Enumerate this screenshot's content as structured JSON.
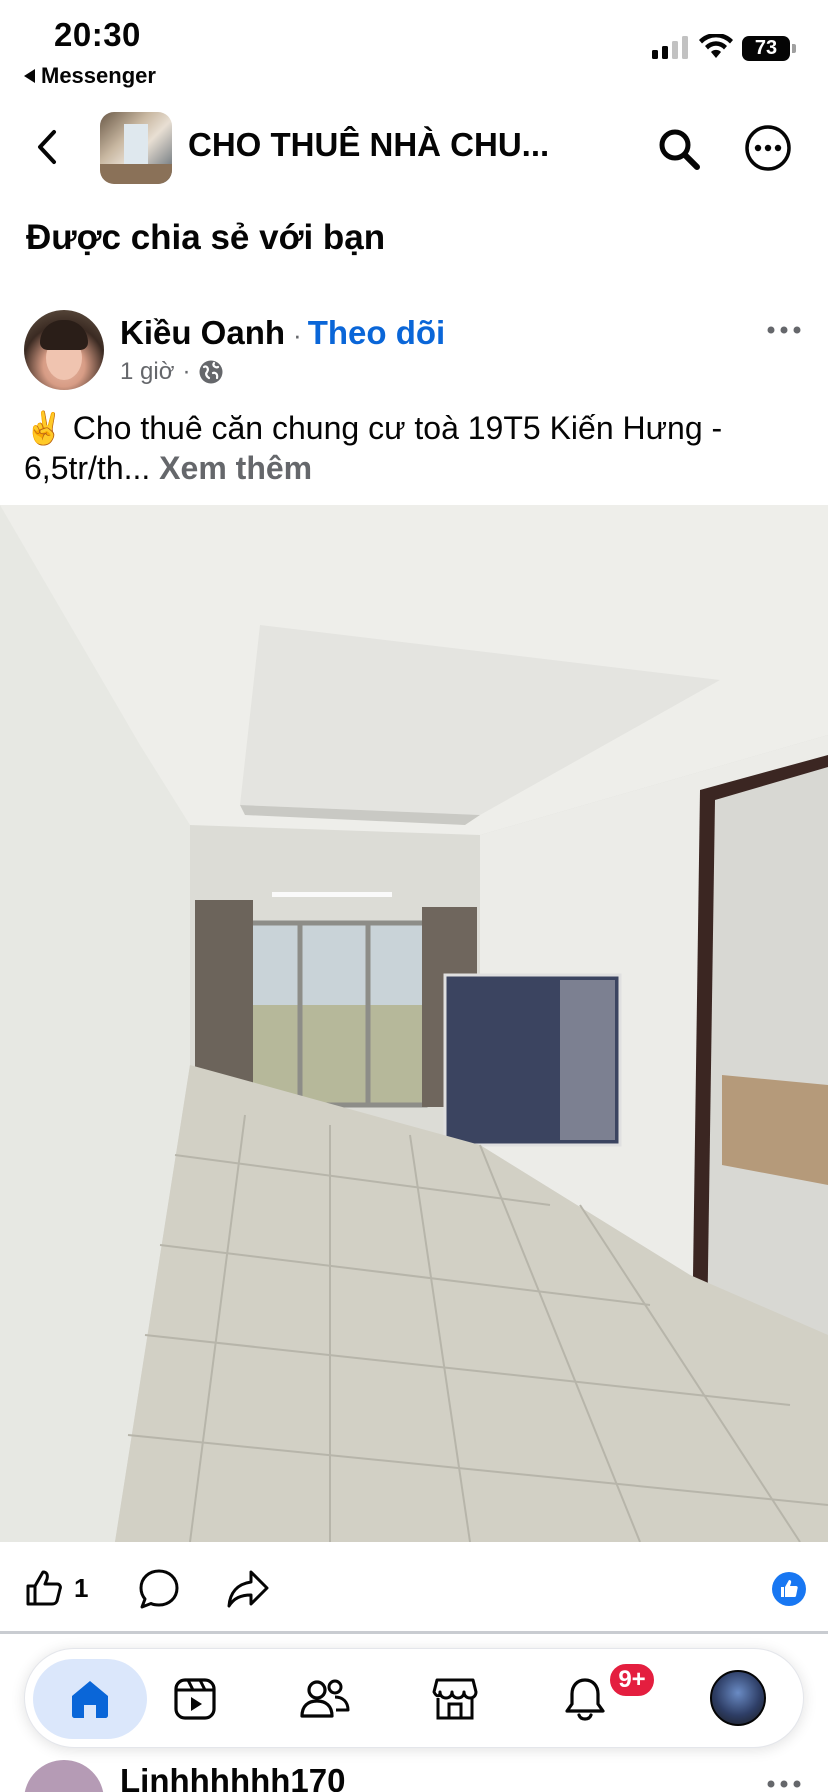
{
  "status_bar": {
    "time": "20:30",
    "back_app": "Messenger",
    "battery": "73"
  },
  "header": {
    "group_title": "CHO THUÊ NHÀ CHU...",
    "icons": [
      "chevron-left-icon",
      "search-icon",
      "more-icon"
    ]
  },
  "shared_title": "Được chia sẻ với bạn",
  "post": {
    "author": "Kiều Oanh",
    "separator": "·",
    "follow_label": "Theo dõi",
    "time": "1 giờ",
    "meta_separator": "·",
    "emoji": "✌️",
    "text": "Cho thuê căn chung cư toà 19T5 Kiến Hưng - 6,5tr/th...",
    "see_more": "Xem thêm",
    "like_count": "1"
  },
  "tabs": [
    {
      "name": "home",
      "icon": "home-icon",
      "active": true
    },
    {
      "name": "video",
      "icon": "video-icon"
    },
    {
      "name": "friends",
      "icon": "friends-icon"
    },
    {
      "name": "marketplace",
      "icon": "marketplace-icon"
    },
    {
      "name": "notifications",
      "icon": "bell-icon",
      "badge": "9+"
    },
    {
      "name": "profile",
      "icon": "avatar"
    }
  ],
  "next_post": {
    "author": "Linhhhhhh170"
  },
  "colors": {
    "accent": "#0a66d8",
    "like_blue": "#1877f2",
    "badge_red": "#e41e3f",
    "muted": "#65676b"
  }
}
